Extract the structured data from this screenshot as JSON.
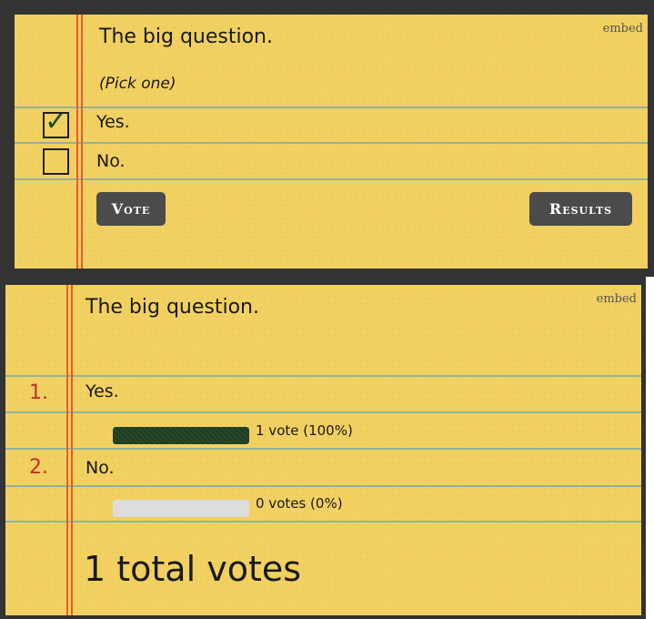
{
  "colors": {
    "paper": "#f2d060",
    "rule": "#8fb39a",
    "margin": "#e85b2a",
    "button": "#4b4b4b",
    "bar_fill": "#1e3d20",
    "bar_empty": "#dddddd",
    "number": "#c0302a"
  },
  "vote_card": {
    "embed_link": "embed",
    "title": "The big question.",
    "hint": "(Pick one)",
    "options": [
      {
        "label": "Yes.",
        "checked": true
      },
      {
        "label": "No.",
        "checked": false
      }
    ],
    "vote_button": "Vote",
    "results_button": "Results",
    "checkmark": "✓"
  },
  "results_card": {
    "embed_link": "embed",
    "title": "The big question.",
    "results": [
      {
        "number": "1.",
        "label": "Yes.",
        "percent": 100,
        "vote_text": "1 vote (100%)"
      },
      {
        "number": "2.",
        "label": "No.",
        "percent": 0,
        "vote_text": "0 votes (0%)"
      }
    ],
    "total": "1 total votes"
  }
}
